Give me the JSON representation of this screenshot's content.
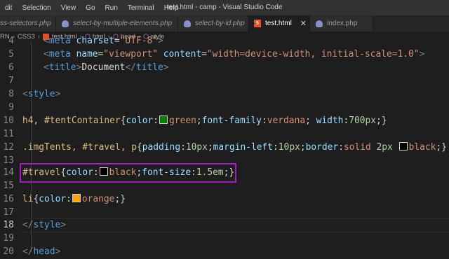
{
  "titlebar": {
    "menu": [
      "dit",
      "Selection",
      "View",
      "Go",
      "Run",
      "Terminal",
      "Help"
    ],
    "window_title": "test.html - camp - Visual Studio Code"
  },
  "tabs": [
    {
      "label": "ss-selectors.php",
      "icon": "php-elephant-icon",
      "active": false
    },
    {
      "label": "select-by-multiple-elements.php",
      "icon": "php-elephant-icon",
      "active": false
    },
    {
      "label": "select-by-id.php",
      "icon": "php-elephant-icon",
      "active": false
    },
    {
      "label": "test.html",
      "icon": "html5-icon",
      "active": true
    },
    {
      "label": "index.php",
      "icon": "php-elephant-icon",
      "active": false
    }
  ],
  "breadcrumb": [
    "RN",
    "CSS3",
    "test.html",
    "html",
    "head",
    "style"
  ],
  "colors": {
    "green_swatch": "#008000",
    "black_swatch": "#000000",
    "orange_swatch": "#ffa500",
    "highlight_border": "#a11dbf"
  },
  "editor": {
    "current_line": "18",
    "lines": [
      {
        "n": "4",
        "code": "<meta charset=\"UTF-8\">"
      },
      {
        "n": "5",
        "code": "<meta name=\"viewport\" content=\"width=device-width, initial-scale=1.0\">"
      },
      {
        "n": "6",
        "code": "<title>Document</title>"
      },
      {
        "n": "7",
        "code": ""
      },
      {
        "n": "8",
        "code": "<style>"
      },
      {
        "n": "9",
        "code": ""
      },
      {
        "n": "10",
        "code": "h4, #tentContainer{color:green;font-family:verdana; width:700px;}"
      },
      {
        "n": "11",
        "code": ""
      },
      {
        "n": "12",
        "code": ".imgTents, #travel, p{padding:10px;margin-left:10px;border:solid 2px black;}"
      },
      {
        "n": "13",
        "code": ""
      },
      {
        "n": "14",
        "code": "#travel{color:black;font-size:1.5em;}"
      },
      {
        "n": "15",
        "code": ""
      },
      {
        "n": "16",
        "code": "li{color:orange;}"
      },
      {
        "n": "17",
        "code": ""
      },
      {
        "n": "18",
        "code": "</style>"
      },
      {
        "n": "19",
        "code": ""
      },
      {
        "n": "20",
        "code": "</head>"
      }
    ]
  }
}
